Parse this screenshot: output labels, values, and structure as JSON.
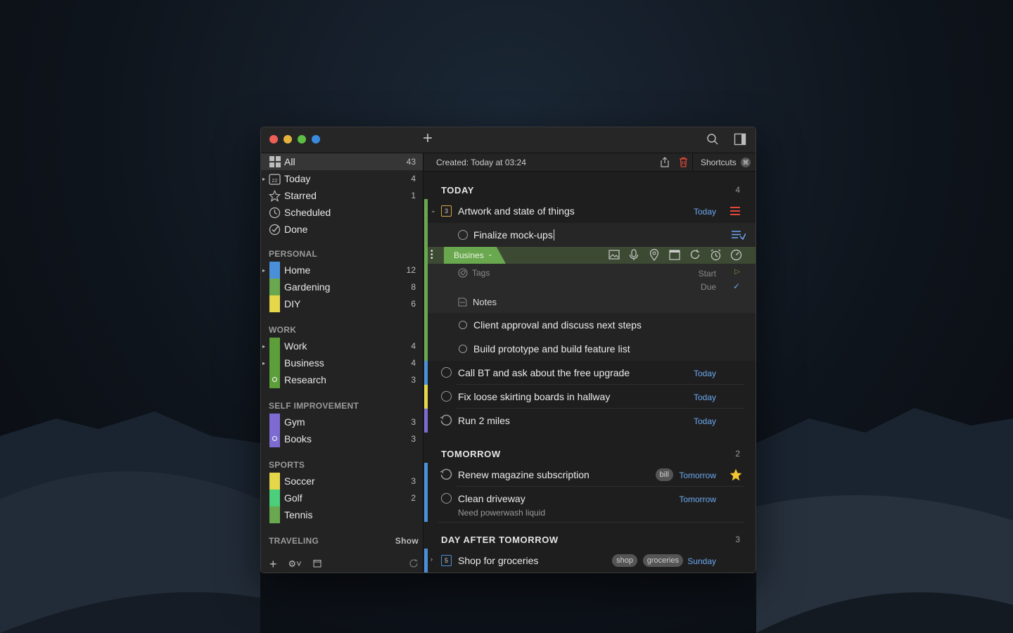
{
  "colors": {
    "accent_green": "#6aa84f",
    "accent_blue": "#4a90d9",
    "accent_yellow": "#e5d64a",
    "accent_purple": "#7d6bd1",
    "link_blue": "#6da8f0",
    "red": "#e0473a",
    "star": "#f5c531"
  },
  "window": {
    "add_icon": "plus-icon",
    "search_icon": "search-icon",
    "sidebar_toggle_icon": "sidebar-toggle-icon"
  },
  "sidebar": {
    "smart_lists": [
      {
        "label": "All",
        "count": "43",
        "icon": "grid-icon"
      },
      {
        "label": "Today",
        "count": "4",
        "icon": "calendar-22-icon",
        "calendar_day": "22"
      },
      {
        "label": "Starred",
        "count": "1",
        "icon": "star-icon"
      },
      {
        "label": "Scheduled",
        "count": "",
        "icon": "clock-icon"
      },
      {
        "label": "Done",
        "count": "",
        "icon": "checkmark-icon"
      }
    ],
    "sections": [
      {
        "title": "PERSONAL",
        "lists": [
          {
            "label": "Home",
            "count": "12",
            "color": "#4a90d9"
          },
          {
            "label": "Gardening",
            "count": "8",
            "color": "#6aa84f"
          },
          {
            "label": "DIY",
            "count": "6",
            "color": "#e5d64a"
          }
        ]
      },
      {
        "title": "WORK",
        "lists": [
          {
            "label": "Work",
            "count": "4",
            "color": "#5b9e3a"
          },
          {
            "label": "Business",
            "count": "4",
            "color": "#5b9e3a"
          },
          {
            "label": "Research",
            "count": "3",
            "color": "#5b9e3a"
          }
        ]
      },
      {
        "title": "SELF IMPROVEMENT",
        "lists": [
          {
            "label": "Gym",
            "count": "3",
            "color": "#7d6bd1"
          },
          {
            "label": "Books",
            "count": "3",
            "color": "#7d6bd1"
          }
        ]
      },
      {
        "title": "SPORTS",
        "lists": [
          {
            "label": "Soccer",
            "count": "3",
            "color": "#e5d64a"
          },
          {
            "label": "Golf",
            "count": "2",
            "color": "#4ccf7a"
          },
          {
            "label": "Tennis",
            "count": "",
            "color": "#6aa84f"
          }
        ]
      }
    ],
    "traveling": {
      "title": "TRAVELING",
      "action": "Show"
    }
  },
  "main": {
    "info": {
      "created": "Created: Today at 03:24",
      "shortcuts_label": "Shortcuts"
    },
    "today": {
      "title": "TODAY",
      "count": "4",
      "project": {
        "title": "Artwork and state of things",
        "subtask_count": "3",
        "date": "Today"
      },
      "editing": {
        "title": "Finalize mock-ups",
        "list_label": "Busines",
        "tags_placeholder": "Tags",
        "start_label": "Start",
        "due_label": "Due",
        "notes_label": "Notes"
      },
      "subtasks": [
        "Client approval and discuss next steps",
        "Build prototype and build feature list"
      ],
      "tasks": [
        {
          "title": "Call BT and ask about the free upgrade",
          "date": "Today"
        },
        {
          "title": "Fix loose skirting boards in hallway",
          "date": "Today"
        },
        {
          "title": "Run 2 miles",
          "date": "Today"
        }
      ]
    },
    "tomorrow": {
      "title": "TOMORROW",
      "count": "2",
      "tasks": [
        {
          "title": "Renew magazine subscription",
          "tag": "bill",
          "date": "Tomorrow"
        },
        {
          "title": "Clean driveway",
          "note": "Need powerwash liquid",
          "date": "Tomorrow"
        }
      ]
    },
    "day_after": {
      "title": "DAY AFTER TOMORROW",
      "count": "3",
      "tasks": [
        {
          "title": "Shop for groceries",
          "subtask_count": "5",
          "tags": [
            "shop",
            "groceries"
          ],
          "date": "Sunday"
        }
      ]
    }
  }
}
